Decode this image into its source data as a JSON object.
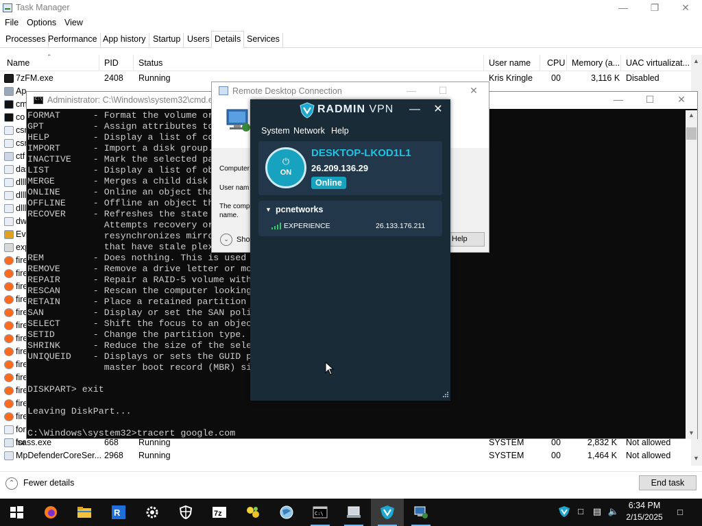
{
  "task_manager": {
    "title": "Task Manager",
    "menu": [
      "File",
      "Options",
      "View"
    ],
    "tabs": [
      "Processes",
      "Performance",
      "App history",
      "Startup",
      "Users",
      "Details",
      "Services"
    ],
    "active_tab": "Details",
    "columns": [
      "Name",
      "PID",
      "Status",
      "User name",
      "CPU",
      "Memory (a...",
      "UAC virtualizat..."
    ],
    "rows_top": [
      {
        "name": "7zFM.exe",
        "pid": "2408",
        "status": "Running",
        "user": "Kris Kringle",
        "cpu": "00",
        "memory": "3,116 K",
        "uac": "Disabled"
      }
    ],
    "side_names": [
      "Ap",
      "cm",
      "co",
      "csr",
      "csr",
      "ctf",
      "das",
      "dlll",
      "dlll",
      "dlll",
      "dw",
      "Eve",
      "exp",
      "fire",
      "fire",
      "fire",
      "fire",
      "fire",
      "fire",
      "fire",
      "fire",
      "fire",
      "fire",
      "fire",
      "fire",
      "fire",
      "for",
      "for"
    ],
    "rows_bottom": [
      {
        "name": "lsass.exe",
        "pid": "668",
        "status": "Running",
        "user": "SYSTEM",
        "cpu": "00",
        "memory": "2,832 K",
        "uac": "Not allowed"
      },
      {
        "name": "MpDefenderCoreSer...",
        "pid": "2968",
        "status": "Running",
        "user": "SYSTEM",
        "cpu": "00",
        "memory": "1,464 K",
        "uac": "Not allowed"
      }
    ],
    "fewer_details": "Fewer details",
    "end_task": "End task"
  },
  "cmd": {
    "title": "Administrator: C:\\Windows\\system32\\cmd.ex",
    "lines": [
      "FORMAT      - Format the volume or",
      "GPT         - Assign attributes to",
      "HELP        - Display a list of co",
      "IMPORT      - Import a disk group.",
      "INACTIVE    - Mark the selected pa",
      "LIST        - Display a list of ob",
      "MERGE       - Merges a child disk",
      "ONLINE      - Online an object tha",
      "OFFLINE     - Offline an object th",
      "RECOVER     - Refreshes the state",
      "              Attempts recovery or",
      "              resynchronizes mirro",
      "              that have stale plex",
      "REM         - Does nothing. This is used",
      "REMOVE      - Remove a drive letter or mo",
      "REPAIR      - Repair a RAID-5 volume with",
      "RESCAN      - Rescan the computer looking",
      "RETAIN      - Place a retained partition",
      "SAN         - Display or set the SAN poli",
      "SELECT      - Shift the focus to an objec",
      "SETID       - Change the partition type.",
      "SHRINK      - Reduce the size of the sele",
      "UNIQUEID    - Displays or sets the GUID p",
      "              master boot record (MBR) si",
      "",
      "DISKPART> exit",
      "",
      "Leaving DiskPart...",
      "",
      "C:\\Windows\\system32>tracert google.com"
    ]
  },
  "rdc": {
    "title": "Remote Desktop Connection",
    "computer_label": "Computer",
    "user_label": "User nam",
    "note_line1": "The comp",
    "note_line2": "name.",
    "show_label": "Show",
    "help_label": "Help"
  },
  "radmin": {
    "brand_main": "RADMIN",
    "brand_vpn": "VPN",
    "menu": [
      "System",
      "Network",
      "Help"
    ],
    "power_label": "ON",
    "hostname": "DESKTOP-LKOD1L1",
    "ip": "26.209.136.29",
    "status": "Online",
    "network_name": "pcnetworks",
    "peer_name": "EXPERIENCE",
    "peer_ip": "26.133.176.211",
    "accent": "#17a2c0"
  },
  "taskbar": {
    "time": "6:34 PM",
    "date": "2/15/2025",
    "apps": [
      "start-icon",
      "firefox-icon",
      "file-explorer-icon",
      "remote-app-icon",
      "settings-icon",
      "security-icon",
      "7zip-icon",
      "network-app-icon",
      "browser-globe-icon",
      "cmd-icon",
      "rdc-icon",
      "radmin-icon",
      "remote-desktop-icon"
    ]
  }
}
